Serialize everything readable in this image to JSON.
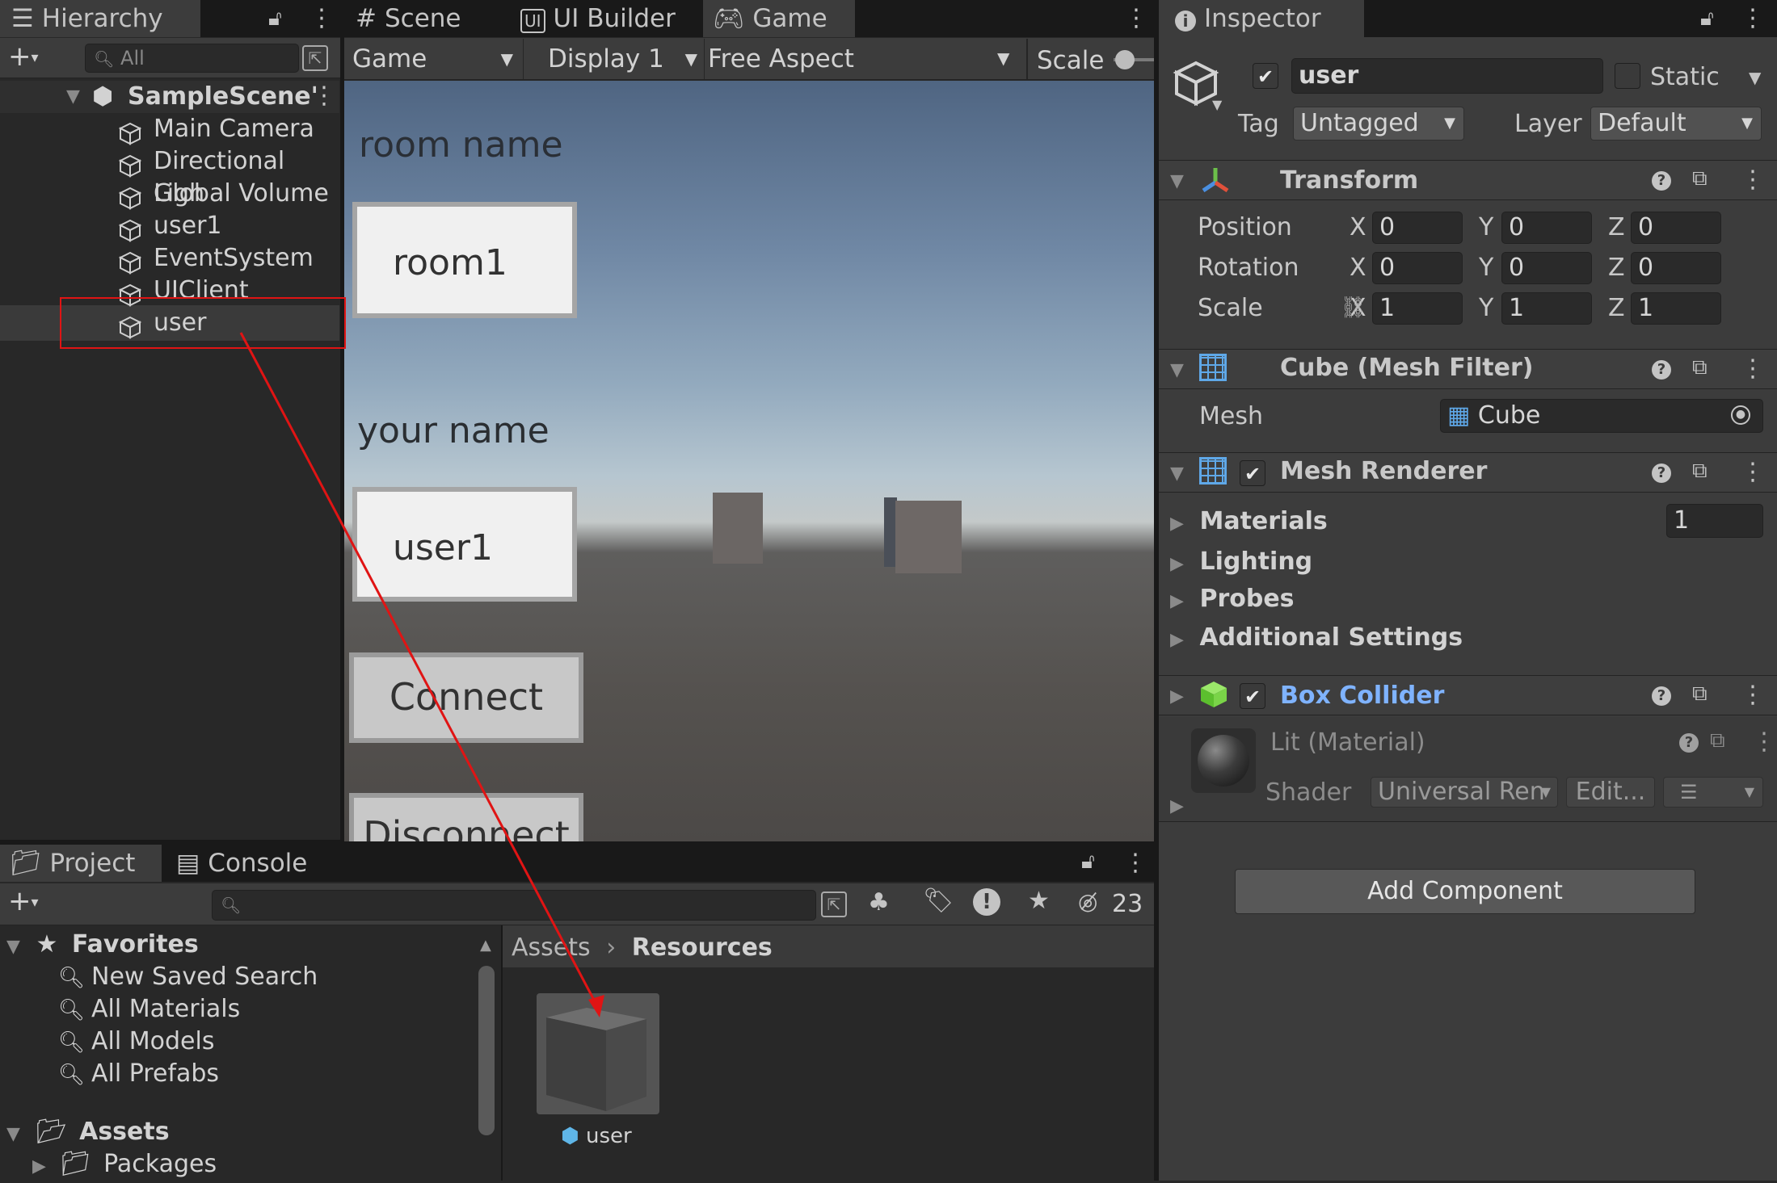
{
  "hierarchy": {
    "tab_label": "Hierarchy",
    "search_placeholder": "All",
    "scene_name": "SampleScene'",
    "items": [
      {
        "label": "Main Camera"
      },
      {
        "label": "Directional Ligh"
      },
      {
        "label": "Global Volume"
      },
      {
        "label": "user1"
      },
      {
        "label": "EventSystem"
      },
      {
        "label": "UIClient"
      },
      {
        "label": "user"
      }
    ]
  },
  "view_tabs": {
    "scene": "Scene",
    "ui_builder": "UI Builder",
    "game": "Game"
  },
  "game_toolbar": {
    "mode": "Game",
    "display": "Display 1",
    "aspect": "Free Aspect",
    "scale_label": "Scale"
  },
  "game_view": {
    "room_label": "room name",
    "room_value": "room1",
    "name_label": "your name",
    "name_value": "user1",
    "connect_button": "Connect",
    "second_button": "Disconnect"
  },
  "inspector": {
    "tab_label": "Inspector",
    "object_name": "user",
    "static_label": "Static",
    "tag_label": "Tag",
    "tag_value": "Untagged",
    "layer_label": "Layer",
    "layer_value": "Default",
    "transform": {
      "title": "Transform",
      "rows": [
        {
          "label": "Position",
          "x": "0",
          "y": "0",
          "z": "0"
        },
        {
          "label": "Rotation",
          "x": "0",
          "y": "0",
          "z": "0"
        },
        {
          "label": "Scale",
          "x": "1",
          "y": "1",
          "z": "1"
        }
      ],
      "axis_x": "X",
      "axis_y": "Y",
      "axis_z": "Z"
    },
    "mesh_filter": {
      "title": "Cube (Mesh Filter)",
      "mesh_label": "Mesh",
      "mesh_value": "Cube"
    },
    "mesh_renderer": {
      "title": "Mesh Renderer",
      "materials_label": "Materials",
      "materials_count": "1",
      "lighting_label": "Lighting",
      "probes_label": "Probes",
      "additional_label": "Additional Settings"
    },
    "box_collider": {
      "title": "Box Collider"
    },
    "material": {
      "title": "Lit (Material)",
      "shader_label": "Shader",
      "shader_value": "Universal Ren",
      "edit_button": "Edit..."
    },
    "add_component": "Add Component"
  },
  "project": {
    "tab_project": "Project",
    "tab_console": "Console",
    "hidden_count": "23",
    "favorites_label": "Favorites",
    "favorites": [
      {
        "label": "New Saved Search"
      },
      {
        "label": "All Materials"
      },
      {
        "label": "All Models"
      },
      {
        "label": "All Prefabs"
      }
    ],
    "assets_label": "Assets",
    "packages_label": "Packages",
    "breadcrumb_root": "Assets",
    "breadcrumb_current": "Resources",
    "asset_name": "user"
  },
  "colors": {
    "annotation": "#e01414",
    "link_blue": "#7fb3ff",
    "selection": "#3a3a3a"
  }
}
